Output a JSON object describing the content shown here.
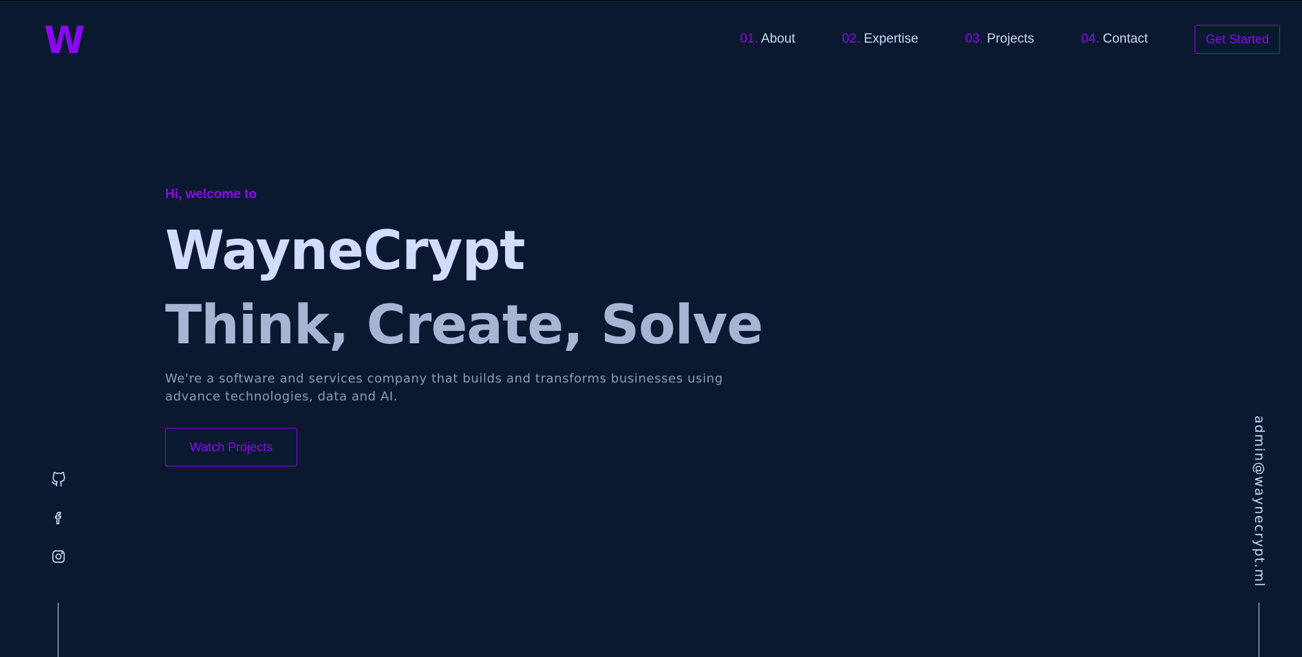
{
  "brand": {
    "logo_text": "W",
    "accent_color": "#8a08f0",
    "background_color": "#0b1930"
  },
  "nav": {
    "items": [
      {
        "number": "01.",
        "label": "About"
      },
      {
        "number": "02.",
        "label": "Expertise"
      },
      {
        "number": "03.",
        "label": "Projects"
      },
      {
        "number": "04.",
        "label": "Contact"
      }
    ],
    "cta_label": "Get Started"
  },
  "hero": {
    "greeting": "Hi, welcome to",
    "title": "WayneCrypt",
    "subtitle": "Think, Create, Solve",
    "description": "We're a software and services company that builds and transforms businesses using advance technologies, data and AI.",
    "button_label": "Watch Projects"
  },
  "socials": [
    {
      "icon": "github-icon"
    },
    {
      "icon": "facebook-icon"
    },
    {
      "icon": "instagram-icon"
    }
  ],
  "contact": {
    "email": "admin@waynecrypt.ml"
  }
}
